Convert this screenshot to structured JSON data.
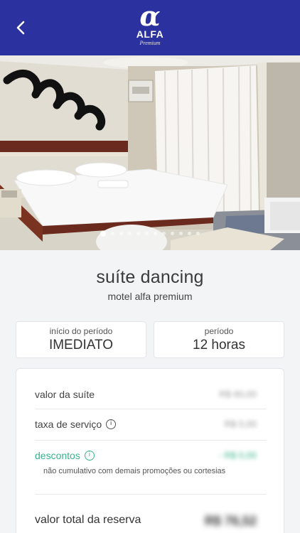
{
  "header": {
    "back_icon": "chevron-left-icon",
    "logo": {
      "symbol": "α",
      "brand": "ALFA",
      "tagline": "Premium"
    },
    "color": "#2b319e"
  },
  "carousel": {
    "slide_count": 12,
    "active_index": 0
  },
  "suite": {
    "name": "suíte dancing",
    "motel": "motel alfa premium"
  },
  "start_card": {
    "label": "início do período",
    "value": "IMEDIATO"
  },
  "period_card": {
    "label": "período",
    "value": "12 horas"
  },
  "pricing": {
    "suite_label": "valor da suíte",
    "suite_value": "R$ 60,00",
    "service_label": "taxa de serviço",
    "service_value": "R$ 0,00",
    "discount_label": "descontos",
    "discount_value": "- R$ 0,00",
    "discount_note": "não cumulativo com demais promoções ou cortesias",
    "total_label": "valor total da reserva",
    "total_value": "R$ 76,52",
    "accent_color": "#37b48c"
  }
}
